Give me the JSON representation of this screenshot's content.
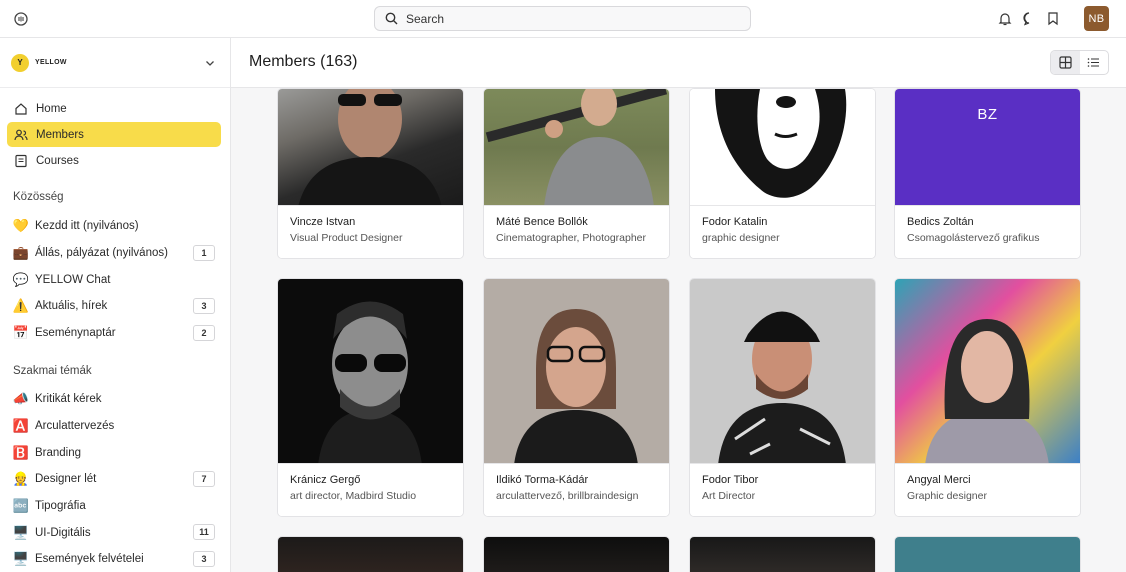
{
  "topbar": {
    "search_placeholder": "Search",
    "avatar_initials": "NB",
    "avatar_color": "#8c5a2e"
  },
  "sidebar": {
    "community_name": "YELLOW",
    "nav": [
      {
        "label": "Home",
        "icon": "home-icon"
      },
      {
        "label": "Members",
        "icon": "members-icon",
        "active": true
      },
      {
        "label": "Courses",
        "icon": "courses-icon"
      }
    ],
    "section1_title": "Közösség",
    "section1_items": [
      {
        "label": "Kezdd itt (nyilvános)",
        "icon": "💛",
        "count": ""
      },
      {
        "label": "Állás, pályázat (nyilvános)",
        "icon": "💼",
        "count": "1"
      },
      {
        "label": "YELLOW Chat",
        "icon": "💬",
        "count": ""
      },
      {
        "label": "Aktuális, hírek",
        "icon": "⚠️",
        "count": "3"
      },
      {
        "label": "Eseménynaptár",
        "icon": "📅",
        "count": "2"
      }
    ],
    "section2_title": "Szakmai témák",
    "section2_items": [
      {
        "label": "Kritikát kérek",
        "icon": "📣",
        "count": ""
      },
      {
        "label": "Arculattervezés",
        "icon": "🅰️",
        "count": ""
      },
      {
        "label": "Branding",
        "icon": "🅱️",
        "count": ""
      },
      {
        "label": "Designer lét",
        "icon": "👷",
        "count": "7"
      },
      {
        "label": "Tipográfia",
        "icon": "🔤",
        "count": ""
      },
      {
        "label": "UI-Digitális",
        "icon": "🖥️",
        "count": "11"
      },
      {
        "label": "Események felvételei",
        "icon": "🖥️",
        "count": "3"
      }
    ]
  },
  "main": {
    "title": "Members (163)",
    "accent": "#f8dc4a",
    "members_row1": [
      {
        "name": "Vincze Istvan",
        "role": "Visual Product Designer"
      },
      {
        "name": "Máté Bence Bollók",
        "role": "Cinematographer, Photographer"
      },
      {
        "name": "Fodor Katalin",
        "role": "graphic designer"
      },
      {
        "name": "Bedics Zoltán",
        "role": "Csomagolástervező grafikus",
        "initials": "BZ",
        "color": "#5a2fc4"
      }
    ],
    "members_row2": [
      {
        "name": "Kránicz Gergő",
        "role": "art director, Madbird Studio"
      },
      {
        "name": "Ildikó Torma-Kádár",
        "role": "arculattervező, brillbraindesign"
      },
      {
        "name": "Fodor Tibor",
        "role": "Art Director"
      },
      {
        "name": "Angyal Merci",
        "role": "Graphic designer"
      }
    ]
  }
}
